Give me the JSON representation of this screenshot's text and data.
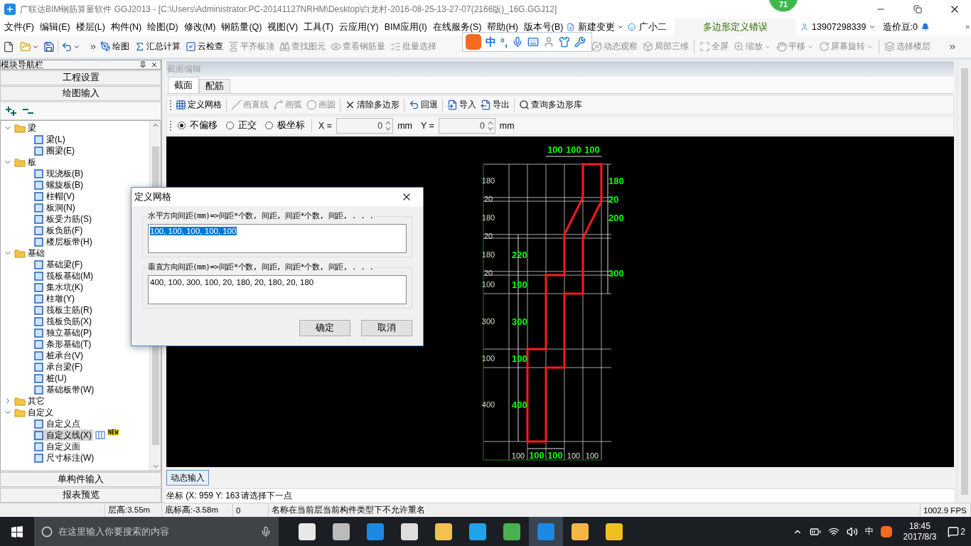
{
  "window": {
    "title": "广联达BIM钢筋算量软件 GGJ2013 - [C:\\Users\\Administrator.PC-20141127NRHM\\Desktop\\白龙村-2016-08-25-13-27-07(2166版)_16G.GGJ12]",
    "badge": "71"
  },
  "menu": [
    "文件(F)",
    "编辑(E)",
    "楼层(L)",
    "构件(N)",
    "绘图(D)",
    "修改(M)",
    "钢筋量(Q)",
    "视图(V)",
    "工具(T)",
    "云应用(Y)",
    "BIM应用(I)",
    "在线服务(S)",
    "帮助(H)",
    "版本号(B)"
  ],
  "menu_extras": {
    "new_change": "新建变更",
    "assistant": "广小二",
    "message": "多边形定义错误",
    "user": "13907298339",
    "beans": "造价豆:0"
  },
  "toolbar": [
    {
      "label": "绘图",
      "disabled": false
    },
    {
      "label": "汇总计算",
      "disabled": false
    },
    {
      "label": "云检查",
      "disabled": false
    },
    {
      "label": "平齐板顶",
      "disabled": true
    },
    {
      "label": "查找图元",
      "disabled": true
    },
    {
      "label": "查看钢筋量",
      "disabled": true
    },
    {
      "label": "批量选择",
      "disabled": true
    },
    {
      "label": "动态观察",
      "disabled": true
    },
    {
      "label": "局部三维",
      "disabled": true
    },
    {
      "label": "全屏",
      "disabled": true
    },
    {
      "label": "缩放",
      "disabled": true
    },
    {
      "label": "平移",
      "disabled": true
    },
    {
      "label": "屏幕旋转",
      "disabled": true
    },
    {
      "label": "选择楼层",
      "disabled": true
    }
  ],
  "ime": {
    "mode": "中",
    "punct": "°,"
  },
  "nav": {
    "title": "模块导航栏",
    "sections_top": [
      "工程设置",
      "绘图输入"
    ],
    "tree": [
      {
        "label": "梁",
        "expanded": true,
        "selected": false,
        "children": [
          {
            "label": "梁(L)",
            "selected": false
          },
          {
            "label": "圈梁(E)",
            "selected": false
          }
        ]
      },
      {
        "label": "板",
        "expanded": true,
        "selected": false,
        "children": [
          {
            "label": "现浇板(B)",
            "selected": false
          },
          {
            "label": "螺旋板(B)",
            "selected": false
          },
          {
            "label": "柱帽(V)",
            "selected": false
          },
          {
            "label": "板洞(N)",
            "selected": false
          },
          {
            "label": "板受力筋(S)",
            "selected": false
          },
          {
            "label": "板负筋(F)",
            "selected": false
          },
          {
            "label": "楼层板带(H)",
            "selected": false
          }
        ]
      },
      {
        "label": "基础",
        "expanded": true,
        "selected": false,
        "children": [
          {
            "label": "基础梁(F)",
            "selected": false
          },
          {
            "label": "筏板基础(M)",
            "selected": false
          },
          {
            "label": "集水坑(K)",
            "selected": false
          },
          {
            "label": "柱墩(Y)",
            "selected": false
          },
          {
            "label": "筏板主筋(R)",
            "selected": false
          },
          {
            "label": "筏板负筋(X)",
            "selected": false
          },
          {
            "label": "独立基础(P)",
            "selected": false
          },
          {
            "label": "条形基础(T)",
            "selected": false
          },
          {
            "label": "桩承台(V)",
            "selected": false
          },
          {
            "label": "承台梁(F)",
            "selected": false
          },
          {
            "label": "桩(U)",
            "selected": false
          },
          {
            "label": "基础板带(W)",
            "selected": false
          }
        ]
      },
      {
        "label": "其它",
        "expanded": false,
        "selected": false
      },
      {
        "label": "自定义",
        "expanded": true,
        "selected": false,
        "children": [
          {
            "label": "自定义点",
            "selected": false
          },
          {
            "label": "自定义线(X)",
            "selected": true,
            "badge": "NEW"
          },
          {
            "label": "自定义面",
            "selected": false
          },
          {
            "label": "尺寸标注(W)",
            "selected": false
          }
        ]
      }
    ],
    "sections_bottom": [
      "单构件输入",
      "报表预览"
    ]
  },
  "editor": {
    "title": "截面编辑",
    "tabs": [
      {
        "label": "截面",
        "selected": true
      },
      {
        "label": "配筋",
        "selected": false
      }
    ],
    "tools": [
      {
        "label": "定义网格",
        "disabled": false
      },
      {
        "label": "画直线",
        "disabled": true
      },
      {
        "label": "画弧",
        "disabled": true
      },
      {
        "label": "画圆",
        "disabled": true
      },
      {
        "label": "清除多边形",
        "disabled": false
      },
      {
        "label": "回退",
        "disabled": false
      },
      {
        "label": "导入",
        "disabled": false
      },
      {
        "label": "导出",
        "disabled": false
      },
      {
        "label": "查询多边形库",
        "disabled": false
      }
    ],
    "snap_modes": [
      {
        "label": "不偏移",
        "selected": true
      },
      {
        "label": "正交",
        "selected": false
      },
      {
        "label": "极坐标",
        "selected": false
      }
    ],
    "x": {
      "label": "X =",
      "value": "0",
      "unit": "mm"
    },
    "y": {
      "label": "Y =",
      "value": "0",
      "unit": "mm"
    },
    "canvas": {
      "top_dims": [
        "100",
        "100",
        "100"
      ],
      "bottom_dims": [
        {
          "text": "100",
          "kind": "grid"
        },
        {
          "text": "100",
          "kind": "shape"
        },
        {
          "text": "100",
          "kind": "shape"
        },
        {
          "text": "100",
          "kind": "grid"
        },
        {
          "text": "100",
          "kind": "grid"
        }
      ],
      "row_dims": [
        "180",
        "20",
        "180",
        "20",
        "180",
        "20",
        "100",
        "300",
        "100",
        "400"
      ],
      "left_dims": [
        "220",
        "100",
        "300",
        "100",
        "400"
      ],
      "right_dims": [
        "180",
        "20",
        "200",
        "300"
      ]
    },
    "dynamic_input": "动态输入",
    "command": {
      "coords": "坐标 (X: 959 Y: 163",
      "prompt": "请选择下一点"
    }
  },
  "dialog": {
    "title": "定义网格",
    "fields": [
      {
        "label": "水平方向间距(mm)=>间距*个数, 间距, 间距*个数, 间距, . . .",
        "value": "100, 100, 100, 100, 100",
        "selected": true
      },
      {
        "label": "垂直方向间距(mm)=>间距*个数, 间距, 间距*个数, 间距, . . .",
        "value": "400, 100, 300, 100, 20, 180, 20, 180, 20, 180",
        "selected": false
      }
    ],
    "buttons": [
      "确定",
      "取消"
    ]
  },
  "status_bar": [
    "层高:3.55m",
    "底标高:-3.58m",
    "0",
    "名称在当前层当前构件类型下不允许重名",
    "1002.9 FPS"
  ],
  "taskbar": {
    "search_placeholder": "在这里输入你要搜索的内容",
    "ime": "中",
    "time": "18:45",
    "date": "2017/8/3",
    "notifications": "2"
  }
}
